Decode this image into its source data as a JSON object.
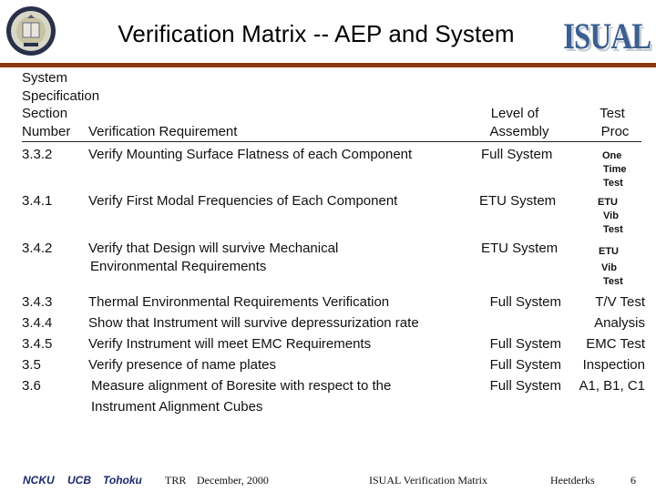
{
  "header": {
    "title": "Verification Matrix  --  AEP and System",
    "logo_text": "ISUAL",
    "seal_icon": "university-seal-icon"
  },
  "columns": {
    "section_lines": [
      "System",
      "Specification",
      "Section",
      "Number"
    ],
    "requirement": "Verification Requirement",
    "level_lines": [
      "Level of",
      "Assembly"
    ],
    "proc_lines": [
      "Test",
      "Proc"
    ]
  },
  "rows": [
    {
      "section": "3.3.2",
      "requirement": [
        "Verify Mounting Surface Flatness of each Component"
      ],
      "level": "Full System",
      "proc": [
        "One",
        "Time",
        "Test"
      ]
    },
    {
      "section": "3.4.1",
      "requirement": [
        "Verify First Modal Frequencies of Each Component"
      ],
      "level": "ETU System",
      "proc": [
        "ETU",
        "Vib",
        "Test"
      ]
    },
    {
      "section": "3.4.2",
      "requirement": [
        "Verify that Design will survive Mechanical",
        "Environmental Requirements"
      ],
      "level": "ETU System",
      "proc": [
        "ETU",
        "Vib",
        "Test"
      ]
    },
    {
      "section": "3.4.3",
      "requirement": [
        "Thermal Environmental Requirements Verification"
      ],
      "level": "Full System",
      "proc": [
        "T/V Test"
      ]
    },
    {
      "section": "3.4.4",
      "requirement": [
        "Show that Instrument will survive depressurization rate"
      ],
      "level": "",
      "proc": [
        "Analysis"
      ]
    },
    {
      "section": "3.4.5",
      "requirement": [
        "Verify Instrument will meet EMC Requirements"
      ],
      "level": "Full System",
      "proc": [
        "EMC Test"
      ]
    },
    {
      "section": "3.5",
      "requirement": [
        "Verify presence of name plates"
      ],
      "level": "Full System",
      "proc": [
        "Inspection"
      ]
    },
    {
      "section": "3.6",
      "requirement": [
        "Measure alignment of Boresite with respect to the",
        "Instrument Alignment Cubes"
      ],
      "level": "Full System",
      "proc": [
        "A1, B1, C1"
      ]
    }
  ],
  "footer": {
    "orgs": [
      "NCKU",
      "UCB",
      "Tohoku"
    ],
    "event": "TRR",
    "date": "December, 2000",
    "doc_title": "ISUAL Verification Matrix",
    "author": "Heetderks",
    "page": "6"
  },
  "colors": {
    "rule": "#8b3a12",
    "logo": "#3b5f8f",
    "footer_orgs": "#1a2a6c"
  }
}
